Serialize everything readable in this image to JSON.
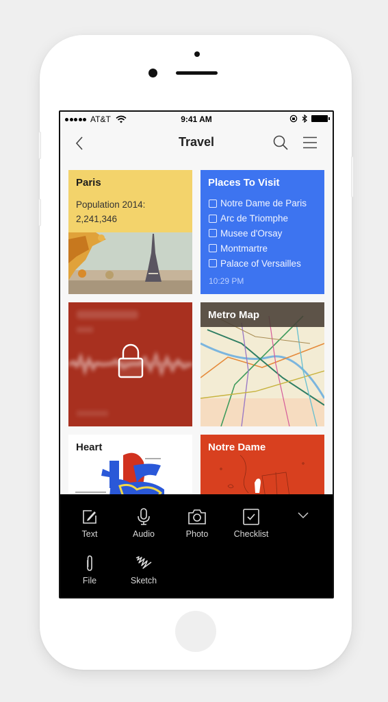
{
  "status_bar": {
    "carrier": "AT&T",
    "time": "9:41 AM"
  },
  "navbar": {
    "title": "Travel"
  },
  "notes": [
    {
      "title": "Paris",
      "body_line1": "Population 2014:",
      "body_line2": "2,241,346",
      "color": "#f3d36b",
      "image": "eiffel-tower-photo"
    },
    {
      "title": "Places To Visit",
      "color": "#3d74f0",
      "checklist": [
        {
          "label": "Notre Dame de Paris",
          "checked": false
        },
        {
          "label": "Arc de Triomphe",
          "checked": false
        },
        {
          "label": "Musee d'Orsay",
          "checked": false
        },
        {
          "label": "Montmartre",
          "checked": false
        },
        {
          "label": "Palace of Versailles",
          "checked": false
        }
      ],
      "timestamp": "10:29 PM"
    },
    {
      "title": "",
      "color": "#a8301f",
      "locked": true,
      "type": "audio"
    },
    {
      "title": "Metro Map",
      "image": "paris-metro-map"
    },
    {
      "title": "Heart",
      "color": "#ffffff",
      "image": "heart-sketch"
    },
    {
      "title": "Notre Dame",
      "color": "#d8401f",
      "image": "notre-dame-doodle"
    }
  ],
  "toolbar": {
    "items": [
      {
        "label": "Text",
        "icon": "pencil-square-icon"
      },
      {
        "label": "Audio",
        "icon": "microphone-icon"
      },
      {
        "label": "Photo",
        "icon": "camera-icon"
      },
      {
        "label": "Checklist",
        "icon": "checkbox-icon"
      },
      {
        "label": "File",
        "icon": "paperclip-icon"
      },
      {
        "label": "Sketch",
        "icon": "squiggle-icon"
      }
    ]
  }
}
